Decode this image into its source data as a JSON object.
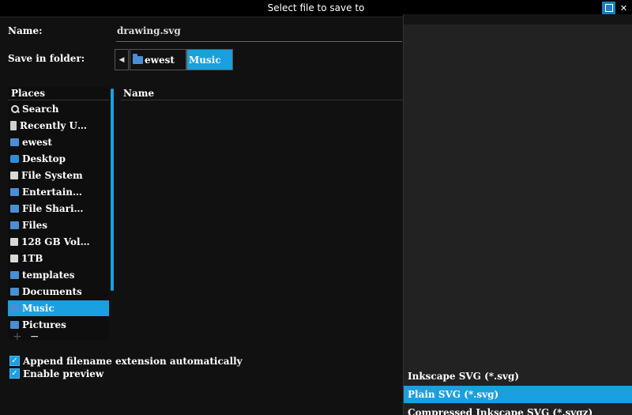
{
  "window": {
    "title": "Select file to save to"
  },
  "form": {
    "name_label": "Name:",
    "name_value": "drawing.svg",
    "folder_label": "Save in folder:",
    "breadcrumbs": [
      "ewest",
      "Music"
    ]
  },
  "places": {
    "header": "Places",
    "items": [
      {
        "label": "Search",
        "icon": "search-icon"
      },
      {
        "label": "Recently U…",
        "icon": "recent-icon"
      },
      {
        "label": "ewest",
        "icon": "home-folder-icon"
      },
      {
        "label": "Desktop",
        "icon": "desktop-icon"
      },
      {
        "label": "File System",
        "icon": "drive-icon"
      },
      {
        "label": "Entertain…",
        "icon": "folder-icon"
      },
      {
        "label": "File Shari…",
        "icon": "folder-icon"
      },
      {
        "label": "Files",
        "icon": "folder-icon"
      },
      {
        "label": "128 GB Vol…",
        "icon": "drive-icon"
      },
      {
        "label": "1TB",
        "icon": "drive-icon"
      },
      {
        "label": "templates",
        "icon": "folder-icon"
      },
      {
        "label": "Documents",
        "icon": "folder-icon"
      },
      {
        "label": "Music",
        "icon": "music-folder-icon",
        "selected": true
      },
      {
        "label": "Pictures",
        "icon": "folder-icon"
      }
    ],
    "add_symbol": "+",
    "remove_symbol": "−"
  },
  "files": {
    "column_name": "Name"
  },
  "options": {
    "append_extension": "Append filename extension automatically",
    "enable_preview": "Enable preview",
    "append_checked": true,
    "preview_checked": true
  },
  "file_types": {
    "items": [
      {
        "label": "Inkscape SVG (*.svg)"
      },
      {
        "label": "Plain SVG (*.svg)",
        "selected": true
      },
      {
        "label": "Compressed Inkscape SVG (*.svgz)"
      }
    ]
  },
  "colors": {
    "accent": "#1a9fe0",
    "background": "#111111",
    "dropdown_bg": "#222222"
  }
}
